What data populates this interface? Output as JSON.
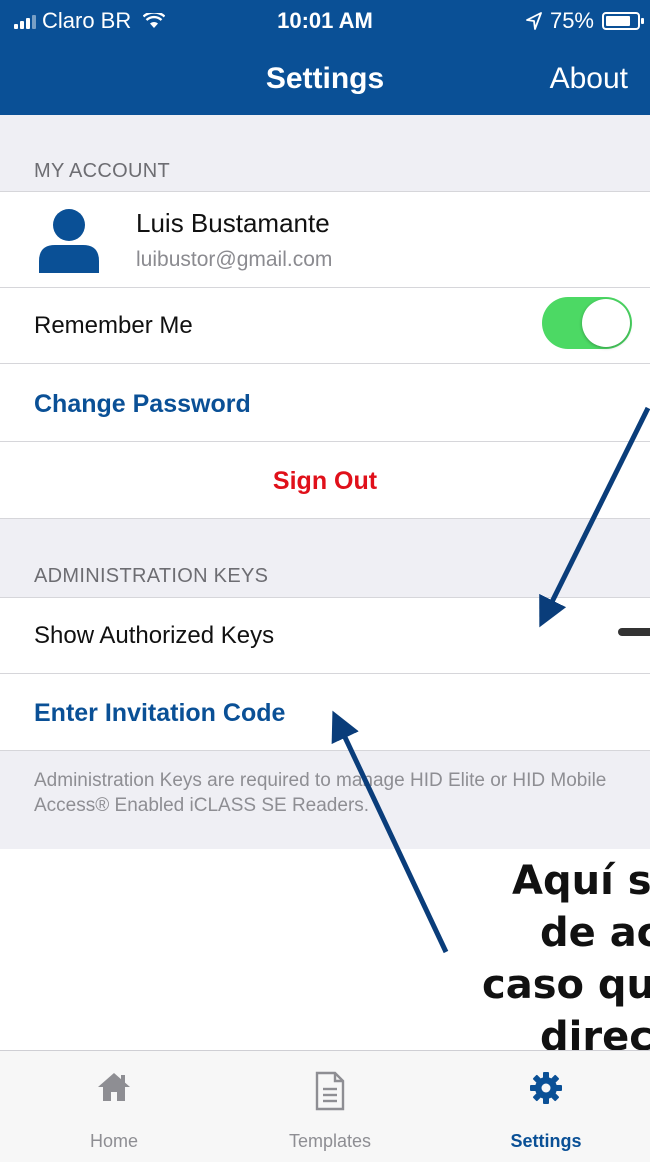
{
  "status_bar": {
    "carrier": "Claro BR",
    "time": "10:01 AM",
    "battery": "75%"
  },
  "nav": {
    "title": "Settings",
    "right_button": "About"
  },
  "my_account": {
    "header": "MY ACCOUNT",
    "user_name": "Luis Bustamante",
    "user_email": "luibustor@gmail.com",
    "remember_me_label": "Remember Me",
    "remember_me_on": true,
    "change_password": "Change Password",
    "sign_out": "Sign Out"
  },
  "admin_keys": {
    "header": "ADMINISTRATION KEYS",
    "show_keys_label": "Show Authorized Keys",
    "enter_code": "Enter Invitation Code",
    "footnote": "Administration Keys are required to manage HID Elite or HID Mobile Access® Enabled iCLASS SE Readers."
  },
  "overlay_text": {
    "line1": "Aquí s",
    "line2": "de act",
    "line3": "caso qu",
    "line4": "direc"
  },
  "tabs": [
    {
      "label": "Home",
      "icon": "home-icon"
    },
    {
      "label": "Templates",
      "icon": "document-icon"
    },
    {
      "label": "Settings",
      "icon": "gear-icon",
      "active": true
    }
  ],
  "colors": {
    "brand": "#0a5096",
    "toggle_on": "#4cd964",
    "destructive": "#e0101a",
    "arrow": "#0a3d7a"
  }
}
